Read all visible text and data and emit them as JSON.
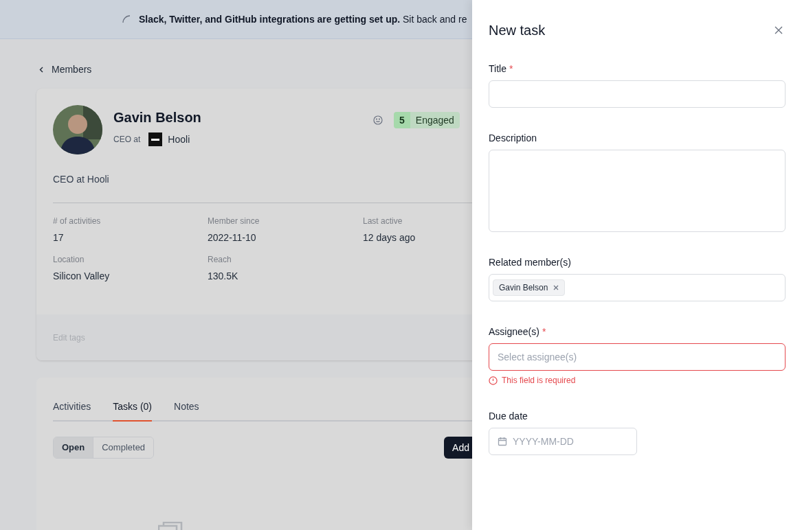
{
  "banner": {
    "text": "**Slack, Twitter, and GitHub integrations are getting set up.** Sit back and re"
  },
  "back_link": "Members",
  "member": {
    "name": "Gavin Belson",
    "role": "CEO at",
    "company": "Hooli",
    "bio": "CEO at Hooli",
    "engagement_score": "5",
    "engagement_label": "Engaged"
  },
  "stats": [
    {
      "label": "# of activities",
      "value": "17"
    },
    {
      "label": "Member since",
      "value": "2022-11-10"
    },
    {
      "label": "Last active",
      "value": "12 days ago"
    },
    {
      "label": "Location",
      "value": "Silicon Valley"
    },
    {
      "label": "Reach",
      "value": "130.5K"
    }
  ],
  "edit_tags": "Edit tags",
  "tabs": [
    {
      "label": "Activities",
      "selected": false
    },
    {
      "label": "Tasks (0)",
      "selected": true
    },
    {
      "label": "Notes",
      "selected": false
    }
  ],
  "task_filter": [
    {
      "label": "Open",
      "selected": true
    },
    {
      "label": "Completed",
      "selected": false
    }
  ],
  "add_button": "Add",
  "drawer": {
    "title": "New task",
    "fields": [
      {
        "kind": "text",
        "label": "Title",
        "required_mark": "*"
      },
      {
        "kind": "textarea",
        "label": "Description"
      },
      {
        "kind": "chips",
        "label": "Related member(s)",
        "chips": [
          "Gavin Belson"
        ]
      },
      {
        "kind": "text",
        "label": "Assignee(s)",
        "required_mark": "*",
        "placeholder": "Select assignee(s)",
        "error": "This field is required"
      },
      {
        "kind": "date",
        "label": "Due date",
        "placeholder": "YYYY-MM-DD"
      }
    ]
  }
}
